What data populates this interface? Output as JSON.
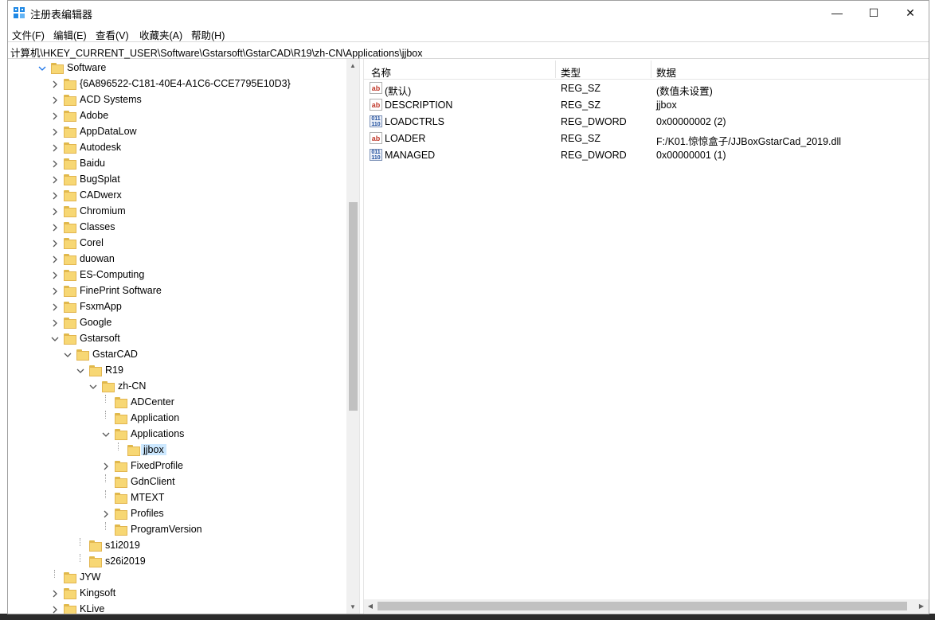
{
  "window": {
    "title": "注册表编辑器",
    "controls": {
      "minimize": "—",
      "maximize": "☐",
      "close": "✕"
    }
  },
  "menu": [
    "文件(F)",
    "编辑(E)",
    "查看(V)",
    "收藏夹(A)",
    "帮助(H)"
  ],
  "address": "计算机\\HKEY_CURRENT_USER\\Software\\Gstarsoft\\GstarCAD\\R19\\zh-CN\\Applications\\jjbox",
  "tree": [
    {
      "label": "Software",
      "expander": "open"
    },
    {
      "label": "{6A896522-C181-40E4-A1C6-CCE7795E10D3}",
      "expander": "closed"
    },
    {
      "label": "ACD Systems",
      "expander": "closed"
    },
    {
      "label": "Adobe",
      "expander": "closed"
    },
    {
      "label": "AppDataLow",
      "expander": "closed"
    },
    {
      "label": "Autodesk",
      "expander": "closed"
    },
    {
      "label": "Baidu",
      "expander": "closed"
    },
    {
      "label": "BugSplat",
      "expander": "closed"
    },
    {
      "label": "CADwerx",
      "expander": "closed"
    },
    {
      "label": "Chromium",
      "expander": "closed"
    },
    {
      "label": "Classes",
      "expander": "closed"
    },
    {
      "label": "Corel",
      "expander": "closed"
    },
    {
      "label": "duowan",
      "expander": "closed"
    },
    {
      "label": "ES-Computing",
      "expander": "closed"
    },
    {
      "label": "FinePrint Software",
      "expander": "closed"
    },
    {
      "label": "FsxmApp",
      "expander": "closed"
    },
    {
      "label": "Google",
      "expander": "closed"
    },
    {
      "label": "Gstarsoft",
      "expander": "open"
    },
    {
      "label": "GstarCAD",
      "expander": "open"
    },
    {
      "label": "R19",
      "expander": "open"
    },
    {
      "label": "zh-CN",
      "expander": "open"
    },
    {
      "label": "ADCenter",
      "expander": "none"
    },
    {
      "label": "Application",
      "expander": "none"
    },
    {
      "label": "Applications",
      "expander": "open"
    },
    {
      "label": "jjbox",
      "expander": "none",
      "selected": true
    },
    {
      "label": "FixedProfile",
      "expander": "closed"
    },
    {
      "label": "GdnClient",
      "expander": "none"
    },
    {
      "label": "MTEXT",
      "expander": "none"
    },
    {
      "label": "Profiles",
      "expander": "closed"
    },
    {
      "label": "ProgramVersion",
      "expander": "none"
    },
    {
      "label": "s1i2019",
      "expander": "none"
    },
    {
      "label": "s26i2019",
      "expander": "none"
    },
    {
      "label": "JYW",
      "expander": "none"
    },
    {
      "label": "Kingsoft",
      "expander": "closed"
    },
    {
      "label": "KLive",
      "expander": "closed"
    }
  ],
  "columns": {
    "name": "名称",
    "type": "类型",
    "data": "数据"
  },
  "values": [
    {
      "icon": "string-value-icon",
      "icon_text": "ab",
      "name": "(默认)",
      "type": "REG_SZ",
      "data": "(数值未设置)"
    },
    {
      "icon": "string-value-icon",
      "icon_text": "ab",
      "name": "DESCRIPTION",
      "type": "REG_SZ",
      "data": "jjbox"
    },
    {
      "icon": "dword-value-icon",
      "icon_text": "011\n110",
      "name": "LOADCTRLS",
      "type": "REG_DWORD",
      "data": "0x00000002 (2)"
    },
    {
      "icon": "string-value-icon",
      "icon_text": "ab",
      "name": "LOADER",
      "type": "REG_SZ",
      "data": "F:/K01.惊惊盒子/JJBoxGstarCad_2019.dll"
    },
    {
      "icon": "dword-value-icon",
      "icon_text": "011\n110",
      "name": "MANAGED",
      "type": "REG_DWORD",
      "data": "0x00000001 (1)"
    }
  ],
  "colors": {
    "selection": "#cce8ff",
    "folder": "#f7d774",
    "scroll_thumb": "#c1c1c1"
  }
}
